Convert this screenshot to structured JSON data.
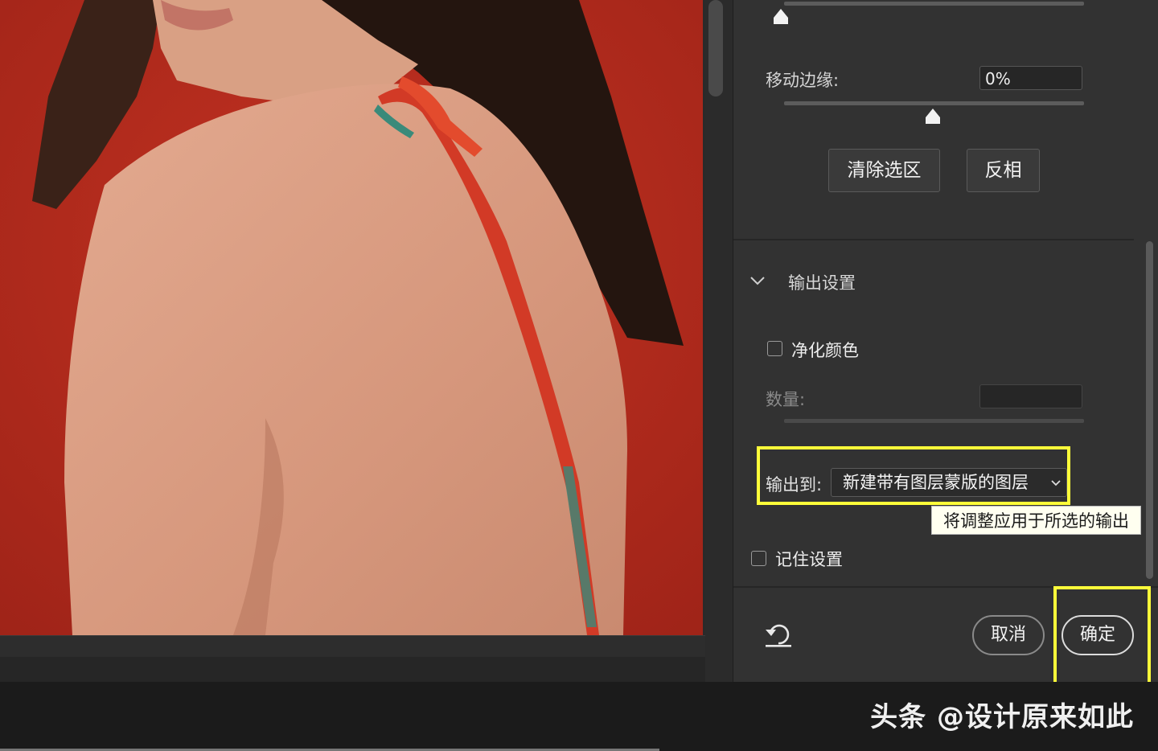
{
  "canvas": {
    "photo_desc_colors": {
      "background": "#b8281c",
      "skin": "#d89a80",
      "hair": "#2a1a14"
    }
  },
  "panel": {
    "shift_edge": {
      "label": "移动边缘:",
      "value": "0%"
    },
    "buttons": {
      "clear_selection": "清除选区",
      "invert": "反相"
    },
    "output_section": {
      "title": "输出设置",
      "decontaminate_label": "净化颜色",
      "amount_label": "数量:",
      "amount_value": "",
      "output_to_label": "输出到:",
      "output_to_value": "新建带有图层蒙版的图层",
      "tooltip": "将调整应用于所选的输出",
      "remember_label": "记住设置"
    },
    "footer": {
      "cancel_label": "取消",
      "ok_label": "确定"
    }
  },
  "watermark": "头条 @设计原来如此",
  "highlight_color": "#ffff3a"
}
